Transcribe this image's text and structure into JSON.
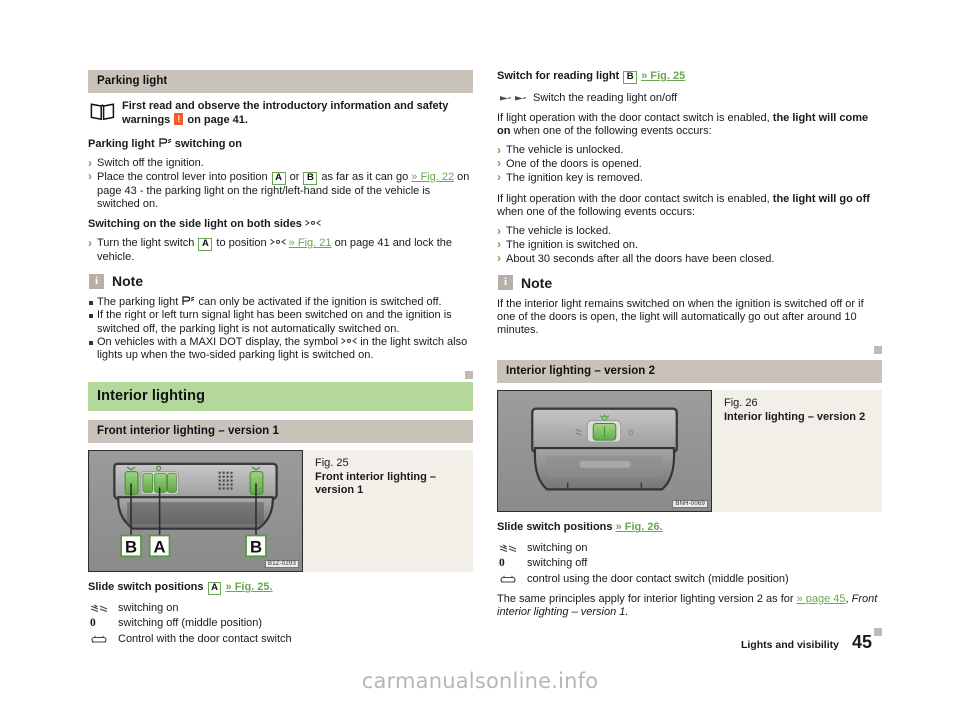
{
  "colors": {
    "section_header_bg": "#b4d79b",
    "subsection_header_bg": "#c9c2ba",
    "reference_green": "#6aa84f",
    "warning_orange": "#f4582c",
    "note_icon_bg": "#b7b0a7",
    "end_marker": "#c2bbb2",
    "watermark": "#b6b6b6"
  },
  "left_column": {
    "parking_light": {
      "header": "Parking light",
      "intro_read": {
        "icon": "open-book-icon",
        "text_before": "First read and observe the introductory information and safety warnings",
        "warning_badge": "!",
        "text_after": "on page 41."
      },
      "switching_on": {
        "heading_pre": "Parking light",
        "heading_symbol": "parking-light-symbol",
        "heading_post": "switching on",
        "items": [
          {
            "text": "Switch off the ignition."
          },
          {
            "text_1": "Place the control lever into position",
            "ref_a": "A",
            "text_2": "or",
            "ref_b": "B",
            "text_3": "as far as it can go",
            "link": "» Fig. 22",
            "text_4": "on page 43 - the parking light on the right/left-hand side of the vehicle is switched on."
          }
        ]
      },
      "side_light": {
        "heading": "Switching on the side light on both sides",
        "heading_symbol": "side-light-symbol",
        "item": {
          "text_1": "Turn the light switch",
          "ref_a": "A",
          "text_2": "to position",
          "symbol": "side-light-symbol",
          "link": "» Fig. 21",
          "text_3": "on page 41 and lock the vehicle."
        }
      },
      "note": {
        "label": "Note",
        "icon": "info-icon",
        "items": [
          {
            "pre": "The parking light",
            "symbol": "parking-light-symbol",
            "post": "can only be activated if the ignition is switched off."
          },
          {
            "pre": "If the right or left turn signal light has been switched on and the ignition is switched off, the parking light is not automatically switched on.",
            "symbol": "",
            "post": ""
          },
          {
            "pre": "On vehicles with a MAXI DOT display, the symbol",
            "symbol": "side-light-symbol",
            "post": "in the light switch also lights up when the two-sided parking light is switched on."
          }
        ]
      }
    },
    "interior_lighting": {
      "header": "Interior lighting",
      "subsection_header": "Front interior lighting – version 1",
      "figure": {
        "caption_line1": "Fig. 25",
        "caption_line2": "Front interior lighting – version 1",
        "image_code": "B1Z-0293",
        "labels": [
          "B",
          "A",
          "B"
        ]
      },
      "slide_switch": {
        "heading": "Slide switch positions",
        "ref_a": "A",
        "link": "» Fig. 25.",
        "rows": [
          {
            "symbol": "interior-light-on-icon",
            "desc": "switching on"
          },
          {
            "symbol": "zero-off-icon",
            "desc": "switching off (middle position)"
          },
          {
            "symbol": "door-contact-switch-icon",
            "desc": "Control with the door contact switch"
          }
        ]
      }
    }
  },
  "right_column": {
    "reading_light": {
      "heading": "Switch for reading light",
      "ref_b": "B",
      "link": "» Fig. 25",
      "symbol_row": {
        "symbol": "reading-light-pair-icon",
        "desc": "Switch the reading light on/off"
      },
      "come_on": {
        "text_1": "If light operation with the door contact switch is enabled,",
        "bold": "the light will come on",
        "text_2": "when one of the following events occurs:",
        "items": [
          "The vehicle is unlocked.",
          "One of the doors is opened.",
          "The ignition key is removed."
        ]
      },
      "go_off": {
        "text_1": "If light operation with the door contact switch is enabled,",
        "bold": "the light will go off",
        "text_2": "when one of the following events occurs:",
        "items": [
          "The vehicle is locked.",
          "The ignition is switched on.",
          "About 30 seconds after all the doors have been closed."
        ]
      },
      "note": {
        "label": "Note",
        "icon": "info-icon",
        "text": "If the interior light remains switched on when the ignition is switched off or if one of the doors is open, the light will automatically go out after around 10 minutes."
      }
    },
    "interior_lighting_v2": {
      "subsection_header": "Interior lighting – version 2",
      "figure": {
        "caption_line1": "Fig. 26",
        "caption_line2": "Interior lighting – version 2",
        "image_code": "BNH-0069"
      },
      "slide_switch": {
        "heading": "Slide switch positions",
        "link": "» Fig. 26.",
        "rows": [
          {
            "symbol": "interior-light-on-icon",
            "desc": "switching on"
          },
          {
            "symbol": "zero-off-icon",
            "desc": "switching off"
          },
          {
            "symbol": "door-contact-switch-icon",
            "desc": "control using the door contact switch (middle position)"
          }
        ]
      },
      "closing_text": {
        "text_1": "The same principles apply for interior lighting version 2 as for",
        "link": "» page 45",
        "text_2": ",",
        "italic": "Front interior lighting – version 1."
      }
    }
  },
  "footer": {
    "section": "Lights and visibility",
    "page_number": "45"
  },
  "watermark": "carmanualsonline.info"
}
